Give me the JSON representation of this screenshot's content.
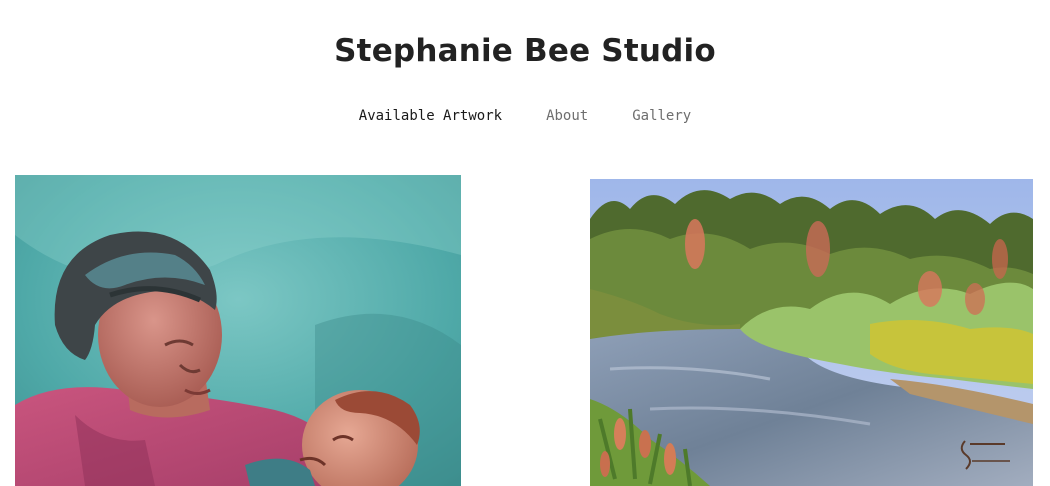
{
  "header": {
    "site_title": "Stephanie Bee Studio"
  },
  "nav": {
    "items": [
      {
        "label": "Available Artwork",
        "active": true
      },
      {
        "label": "About",
        "active": false
      },
      {
        "label": "Gallery",
        "active": false
      }
    ]
  },
  "colors": {
    "text_dark": "#222222",
    "nav_inactive": "#6e6e6e",
    "background": "#ffffff"
  },
  "artworks": [
    {
      "subject": "grandmother-and-baby-painting"
    },
    {
      "subject": "river-landscape-painting"
    }
  ]
}
